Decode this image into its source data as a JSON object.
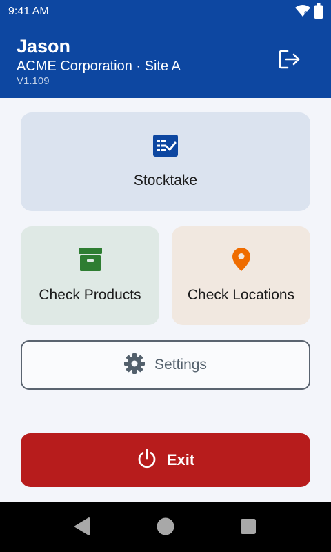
{
  "status_bar": {
    "time": "9:41 AM",
    "icons": [
      "wifi-icon",
      "battery-icon"
    ]
  },
  "header": {
    "user_name": "Jason",
    "company": "ACME Corporation · Site A",
    "version": "V1.109",
    "logout_icon": "logout-icon"
  },
  "tiles": {
    "stocktake": {
      "label": "Stocktake",
      "icon": "checklist-icon"
    },
    "check_products": {
      "label": "Check Products",
      "icon": "archive-box-icon"
    },
    "check_locations": {
      "label": "Check Locations",
      "icon": "location-pin-icon"
    }
  },
  "settings": {
    "label": "Settings",
    "icon": "gear-icon"
  },
  "exit": {
    "label": "Exit",
    "icon": "power-icon"
  },
  "nav_bar": {
    "buttons": [
      "back-icon",
      "home-icon",
      "recents-icon"
    ]
  },
  "colors": {
    "primary": "#0d47a1",
    "stocktake_bg": "#dbe3ef",
    "products_bg": "#dfe9e5",
    "locations_bg": "#f1e8e0",
    "products_icon": "#2e7d32",
    "locations_icon": "#ef6c00",
    "exit_bg": "#b71c1c"
  }
}
